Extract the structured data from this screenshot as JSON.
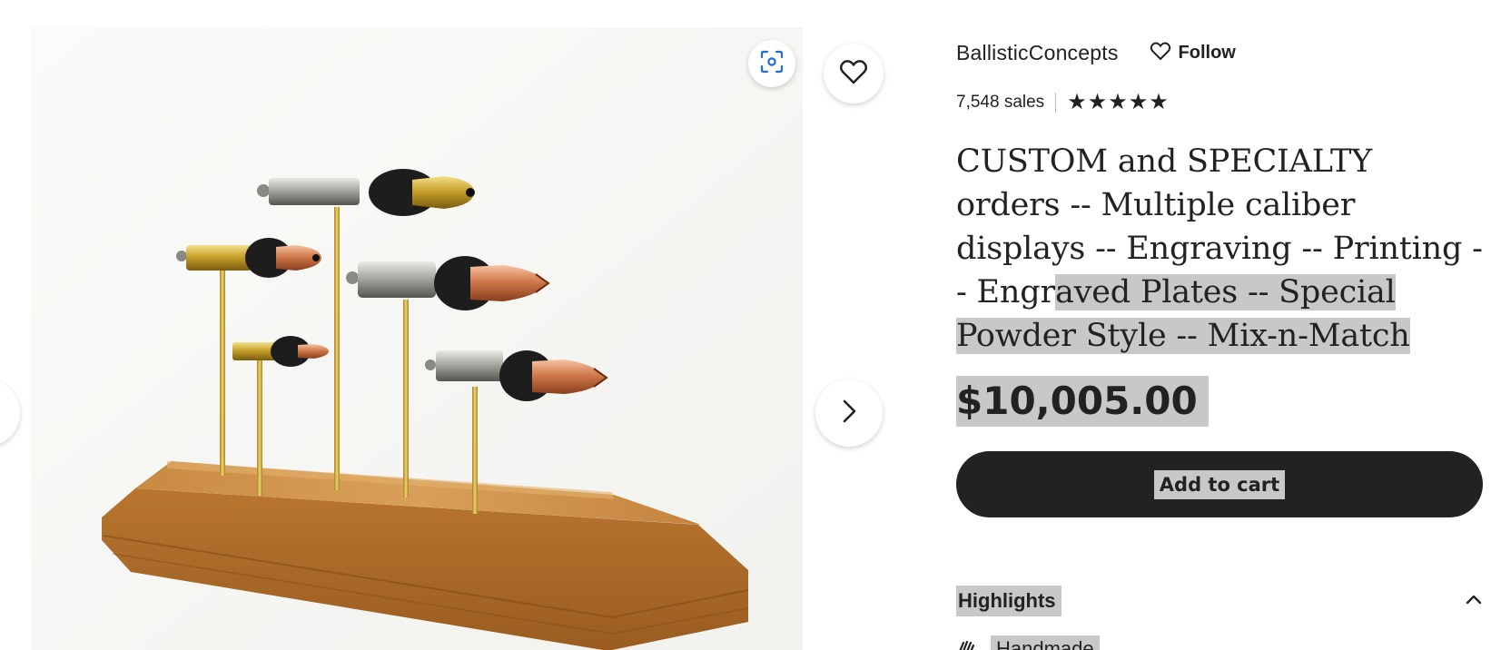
{
  "gallery": {
    "icons": {
      "zoom": "scan-zoom-icon",
      "favorite": "heart-icon",
      "next": "chevron-right-icon",
      "previous": "chevron-left-icon"
    }
  },
  "shop": {
    "name": "BallisticConcepts",
    "follow_label": "Follow",
    "follow_icon": "heart-outline-icon",
    "sales": "7,548 sales",
    "rating_stars": 5
  },
  "product": {
    "title_plain": "CUSTOM and SPECIALTY orders -- Multiple caliber displays -- Engraving -- Printing -- Engr",
    "title_selected": "aved Plates -- Special Powder Style -- Mix-n-Match",
    "price": "$10,005.00",
    "add_to_cart_label": "Add to cart"
  },
  "highlights": {
    "label": "Highlights",
    "expanded_icon": "chevron-up-icon",
    "items": [
      {
        "icon": "hand-icon",
        "label": "Handmade"
      }
    ]
  },
  "colors": {
    "text": "#222222",
    "button_bg": "#222222",
    "selection_highlight": "#c8c8c8",
    "zoom_icon_accent": "#1f6fd1"
  }
}
